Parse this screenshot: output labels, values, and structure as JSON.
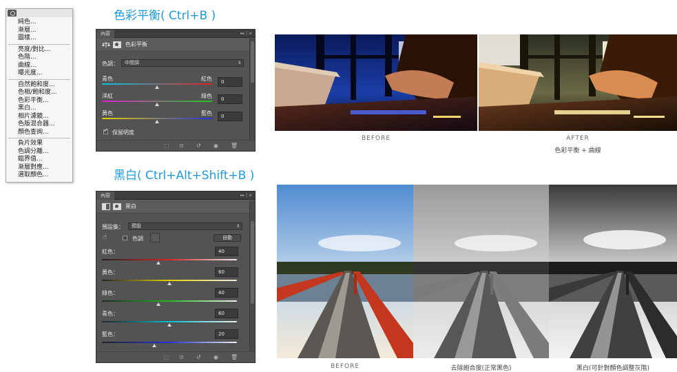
{
  "menu": {
    "groups": [
      [
        "純色...",
        "漸層...",
        "圖樣..."
      ],
      [
        "亮度/對比...",
        "色階...",
        "曲線...",
        "曝光度..."
      ],
      [
        "自然飽和度...",
        "色相/飽和度...",
        "色彩平衡...",
        "黑白...",
        "相片濾鏡...",
        "色版混合器...",
        "顏色查詢..."
      ],
      [
        "負片效果",
        "色調分離...",
        "臨界值...",
        "漸層對應...",
        "選取顏色..."
      ]
    ]
  },
  "section1": {
    "title": "色彩平衡( Ctrl+B )",
    "panel": {
      "tab": "內容",
      "tab_controls": "▸▸ | ≡",
      "adjustment_name": "色彩平衡",
      "tone_label": "色調：",
      "tone_value": "中間調",
      "sliders": [
        {
          "left": "青色",
          "right": "紅色",
          "value": "0",
          "level": 0.5
        },
        {
          "left": "洋紅",
          "right": "綠色",
          "value": "0",
          "level": 0.5
        },
        {
          "left": "黃色",
          "right": "藍色",
          "value": "0",
          "level": 0.5
        }
      ],
      "preserve_label": "保留明度",
      "preserve_checked": true
    },
    "before_caption": "BEFORE",
    "after_caption": "AFTER",
    "after_subcaption": "色彩平衡 + 曲線"
  },
  "section2": {
    "title": "黑白( Ctrl+Alt+Shift+B )",
    "panel": {
      "tab": "內容",
      "tab_controls": "▸▸ | ≡",
      "adjustment_name": "黑白",
      "preset_label": "預設集：",
      "preset_value": "預設",
      "tint_label": "色調",
      "auto_label": "自動",
      "sliders": [
        {
          "label": "紅色：",
          "value": "40",
          "level": 0.42
        },
        {
          "label": "黃色：",
          "value": "60",
          "level": 0.5
        },
        {
          "label": "綠色：",
          "value": "40",
          "level": 0.42
        },
        {
          "label": "青色：",
          "value": "60",
          "level": 0.5
        },
        {
          "label": "藍色：",
          "value": "20",
          "level": 0.39
        }
      ]
    },
    "captions": [
      "BEFORE",
      "去除飽合度(正常黑色)",
      "黑白(可針對顏色調整灰階)"
    ]
  },
  "colors": {
    "title_blue": "#1d9be0",
    "panel_bg": "#535353"
  }
}
